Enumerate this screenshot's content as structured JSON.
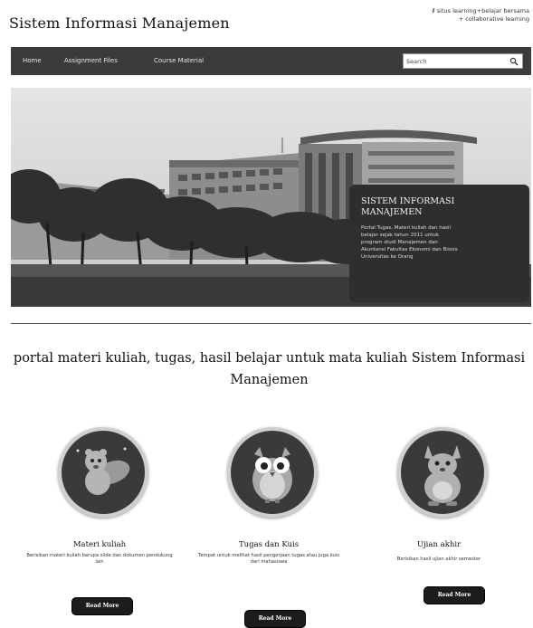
{
  "header": {
    "site_title": "Sistem Informasi Manajemen",
    "tagline_line1": "situs learning+belajar bersama",
    "tagline_line2": "+ collaborative learning"
  },
  "nav": {
    "items": [
      {
        "label": "Home"
      },
      {
        "label": "Assignment Files"
      },
      {
        "label": "Course Material"
      }
    ],
    "search_value": "Search"
  },
  "hero": {
    "caption_title": "SISTEM INFORMASI MANAJEMEN",
    "caption_body": "Portal Tugas, Materi kuliah dan hasil belajar sejak tahun 2011 untuk program studi Manajemen dan Akuntansi Fakultas Ekonomi dan Bisnis Universitas ke Orang"
  },
  "intro": {
    "text": "portal materi kuliah, tugas, hasil belajar untuk mata kuliah Sistem Informasi Manajemen"
  },
  "features": [
    {
      "icon": "squirrel-icon",
      "title": "Materi kuliah",
      "desc": "Berisikan materi kuliah berupa slide dan dokumen pendukung lain",
      "button": "Read More"
    },
    {
      "icon": "owl-icon",
      "title": "Tugas dan Kuis",
      "desc": "Tempat untuk melihat hasil pengerjaan tugas atau juga kuis dari mahasiswa",
      "button": "Read More"
    },
    {
      "icon": "kangaroo-icon",
      "title": "Ujian akhir",
      "desc": "Berisikan hasil ujian akhir semester",
      "button": "Read More"
    }
  ],
  "colors": {
    "navbar": "#3b3b3b",
    "button": "#1c1c1c",
    "caption_bg": "#2e2e2e"
  }
}
